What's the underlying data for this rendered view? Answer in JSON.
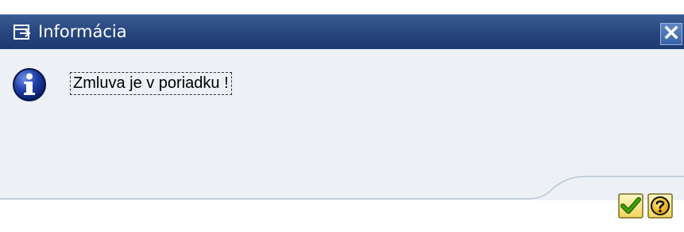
{
  "window": {
    "title": "Informácia",
    "title_icon": "window-icon",
    "close_icon": "close-icon"
  },
  "message": {
    "icon": "info-icon",
    "text": "Zmluva je v poriadku !"
  },
  "buttons": {
    "ok": {
      "icon": "checkmark-icon",
      "color": "#2e8b00"
    },
    "help": {
      "icon": "help-icon",
      "color": "#e8a800"
    }
  },
  "colors": {
    "titlebar": "#26457e",
    "content_bg": "#edf1f6",
    "info_blue": "#1e3fa8"
  }
}
